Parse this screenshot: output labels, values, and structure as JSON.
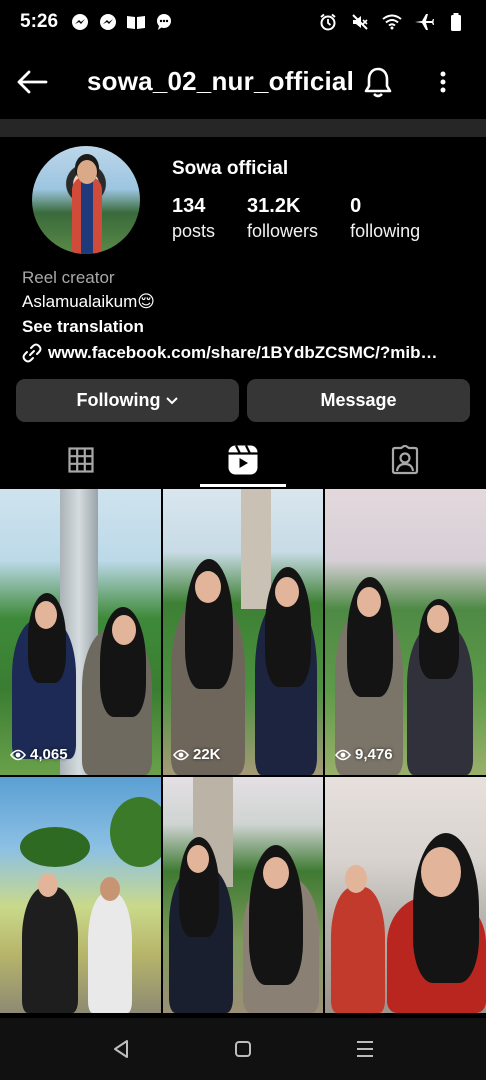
{
  "status": {
    "time": "5:26",
    "left_icons": [
      "messenger-icon",
      "messenger-icon",
      "book-icon",
      "chat-icon"
    ],
    "right_icons": [
      "alarm-icon",
      "mute-icon",
      "wifi-icon",
      "airplane-icon",
      "battery-icon"
    ]
  },
  "header": {
    "username": "sowa_02_nur_official"
  },
  "profile": {
    "display_name": "Sowa official",
    "posts_count": "134",
    "posts_label": "posts",
    "followers_count": "31.2K",
    "followers_label": "followers",
    "following_count": "0",
    "following_label": "following"
  },
  "bio": {
    "category": "Reel creator",
    "text": "Aslamualaikum😌",
    "translate": "See translation",
    "link": "www.facebook.com/share/1BYdbZCSMC/?mib…"
  },
  "actions": {
    "following_label": "Following",
    "message_label": "Message"
  },
  "tabs": [
    "grid-icon",
    "reels-icon",
    "tagged-icon"
  ],
  "active_tab": "reels",
  "reels": [
    {
      "views": "4,065"
    },
    {
      "views": "22K"
    },
    {
      "views": "9,476"
    },
    {
      "views": ""
    },
    {
      "views": ""
    },
    {
      "views": ""
    }
  ]
}
